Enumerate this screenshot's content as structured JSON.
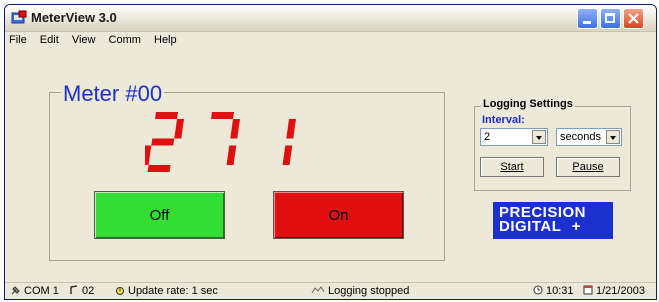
{
  "window": {
    "title": "MeterView 3.0"
  },
  "menu": [
    "File",
    "Edit",
    "View",
    "Comm",
    "Help"
  ],
  "meter": {
    "title": "Meter #00",
    "reading": "271",
    "display_color": "#e01010",
    "off_label": "Off",
    "on_label": "On",
    "off_color": "#33dd33",
    "on_color": "#e01010"
  },
  "logging": {
    "title": "Logging Settings",
    "interval_label": "Interval:",
    "interval_value": "2",
    "interval_unit": "seconds",
    "start_label": "Start",
    "pause_label": "Pause"
  },
  "logo": {
    "line1": "PRECISION",
    "line2": "DIGITAL",
    "symbol": "+"
  },
  "status": {
    "port": "COM 1",
    "address": "02",
    "update_rate": "Update rate: 1 sec",
    "logging": "Logging stopped",
    "time": "10:31",
    "date": "1/21/2003"
  }
}
